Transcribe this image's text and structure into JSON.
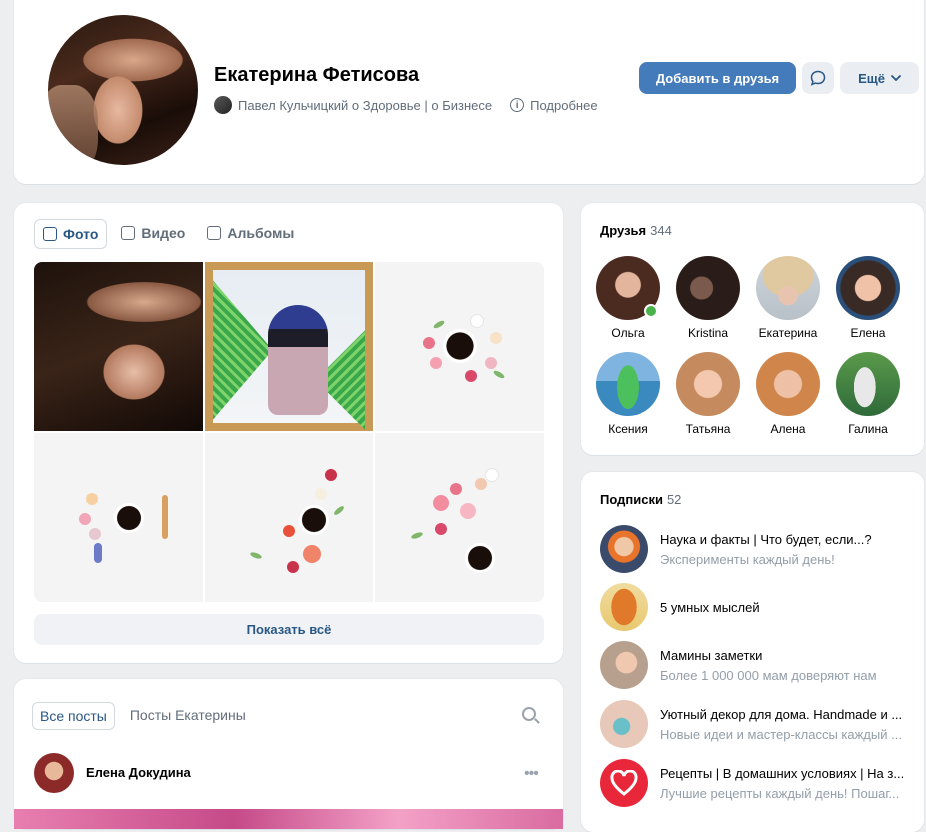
{
  "profile": {
    "name": "Екатерина Фетисова",
    "subtitle": "Павел Кульчицкий о Здоровье | о Бизнесе",
    "details_link": "Подробнее",
    "add_friend": "Добавить в друзья",
    "more": "Ещё"
  },
  "photos": {
    "tabs": [
      "Фото",
      "Видео",
      "Альбомы"
    ],
    "show_all": "Показать всё"
  },
  "posts": {
    "tabs": [
      "Все посты",
      "Посты Екатерины"
    ],
    "author": "Елена Докудина",
    "dots": "•••"
  },
  "friends": {
    "title": "Друзья",
    "count": "344",
    "items": [
      {
        "name": "Ольга",
        "online": true
      },
      {
        "name": "Kristina"
      },
      {
        "name": "Екатерина"
      },
      {
        "name": "Елена"
      },
      {
        "name": "Ксения"
      },
      {
        "name": "Татьяна"
      },
      {
        "name": "Алена"
      },
      {
        "name": "Галина"
      }
    ]
  },
  "subscriptions": {
    "title": "Подписки",
    "count": "52",
    "items": [
      {
        "title": "Наука и факты | Что будет, если...?",
        "desc": "Эксперименты каждый день!",
        "desc_color": "#939ea9"
      },
      {
        "title": "5 умных мыслей",
        "desc": ""
      },
      {
        "title": "Мамины заметки",
        "desc": "Более 1 000 000 мам доверяют нам"
      },
      {
        "title": "Уютный декор для дома. Handmade и ...",
        "desc": "Новые идеи и мастер-классы каждый ..."
      },
      {
        "title": "Рецепты | В домашних условиях | На з...",
        "desc": "Лучшие рецепты каждый день! Пошаг..."
      }
    ]
  },
  "colors": {
    "accent": "#447bba",
    "link": "#2a5885",
    "online": "#4bb34b"
  }
}
